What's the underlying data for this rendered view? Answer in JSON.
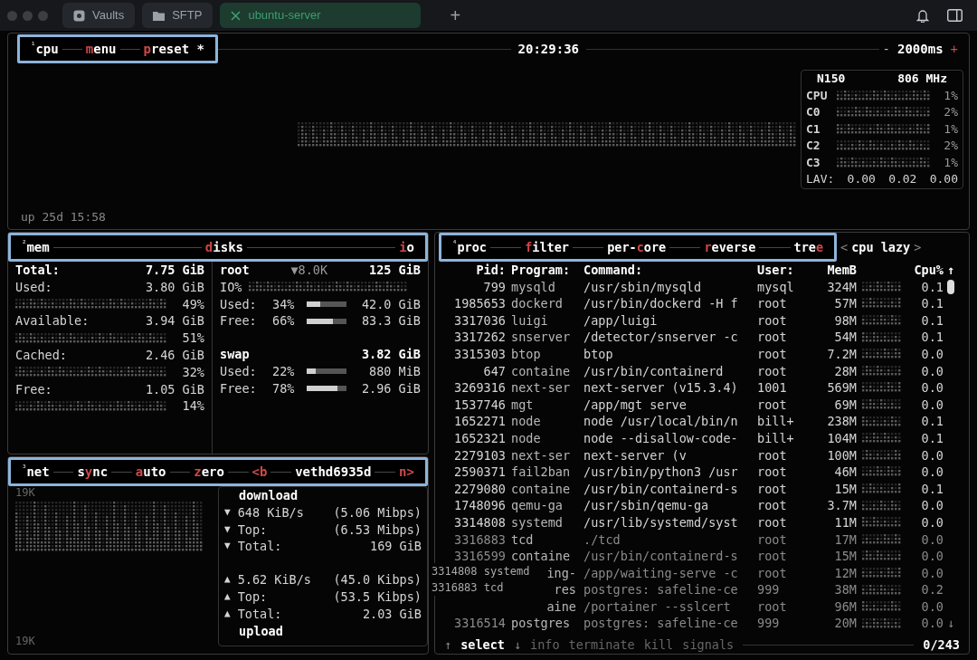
{
  "window": {
    "new_tab": "+"
  },
  "tabs": [
    {
      "label": "Vaults",
      "kind": "vault",
      "selected": false
    },
    {
      "label": "SFTP",
      "kind": "folder",
      "selected": false
    },
    {
      "label": "ubuntu-server",
      "kind": "close",
      "selected": true
    }
  ],
  "cpu": {
    "header": [
      {
        "kind": "title",
        "number": "¹",
        "text": "cpu"
      },
      {
        "kind": "button",
        "hot": "m",
        "post": "enu"
      },
      {
        "kind": "button",
        "hot": "p",
        "post": "reset *"
      }
    ],
    "clock": "20:29:36",
    "interval_minus": "-",
    "interval": "2000ms",
    "interval_plus": "+",
    "model": "N150",
    "frequency": "806 MHz",
    "cores": [
      {
        "name": "CPU",
        "percent": "1%"
      },
      {
        "name": "C0",
        "percent": "2%"
      },
      {
        "name": "C1",
        "percent": "1%"
      },
      {
        "name": "C2",
        "percent": "2%"
      },
      {
        "name": "C3",
        "percent": "1%"
      }
    ],
    "load_label": "LAV:",
    "load": [
      "0.00",
      "0.02",
      "0.00"
    ],
    "uptime": "up 25d 15:58"
  },
  "mem": {
    "header": [
      {
        "kind": "title",
        "number": "²",
        "text": "mem"
      },
      {
        "kind": "button",
        "hot": "d",
        "post": "isks"
      },
      {
        "kind": "button",
        "hot": "i",
        "post": "o"
      }
    ],
    "total_label": "Total:",
    "total": "7.75 GiB",
    "items": [
      {
        "label": "Used:",
        "value": "3.80 GiB",
        "percent": "49%"
      },
      {
        "label": "Available:",
        "value": "3.94 GiB",
        "percent": "51%"
      },
      {
        "label": "Cached:",
        "value": "2.46 GiB",
        "percent": "32%"
      },
      {
        "label": "Free:",
        "value": "1.05 GiB",
        "percent": "14%"
      }
    ]
  },
  "disks": [
    {
      "name": "root",
      "io": "▼8.0K",
      "size": "125 GiB",
      "io_label": "IO%",
      "rows": [
        {
          "label": "Used:",
          "percent": "34%",
          "level": 0.34,
          "value": "42.0 GiB"
        },
        {
          "label": "Free:",
          "percent": "66%",
          "level": 0.66,
          "value": "83.3 GiB"
        }
      ]
    },
    {
      "name": "swap",
      "size": "3.82 GiB",
      "rows": [
        {
          "label": "Used:",
          "percent": "22%",
          "level": 0.22,
          "value": "880 MiB"
        },
        {
          "label": "Free:",
          "percent": "78%",
          "level": 0.78,
          "value": "2.96 GiB"
        }
      ]
    }
  ],
  "net": {
    "header": [
      {
        "kind": "title",
        "number": "³",
        "text": "net"
      },
      {
        "kind": "button",
        "pre": "s",
        "hot": "y",
        "post": "nc"
      },
      {
        "kind": "button",
        "hot": "a",
        "post": "uto"
      },
      {
        "kind": "button",
        "hot": "z",
        "post": "ero"
      },
      {
        "kind": "button",
        "hot": "<b"
      },
      {
        "kind": "plain",
        "pre": "vethd6935d"
      },
      {
        "kind": "button",
        "hot": "n>"
      }
    ],
    "scale_top": "19K",
    "scale_bottom": "19K",
    "download_label": "download",
    "upload_label": "upload",
    "download": [
      {
        "arrow": "▼",
        "label": "648 KiB/s",
        "value": "(5.06 Mibps)"
      },
      {
        "arrow": "▼",
        "label": "Top:",
        "value": "(6.53 Mibps)"
      },
      {
        "arrow": "▼",
        "label": "Total:",
        "value": "169 GiB"
      }
    ],
    "upload": [
      {
        "arrow": "▲",
        "label": "5.62 KiB/s",
        "value": "(45.0 Kibps)"
      },
      {
        "arrow": "▲",
        "label": "Top:",
        "value": "(53.5 Kibps)"
      },
      {
        "arrow": "▲",
        "label": "Total:",
        "value": "2.03 GiB"
      }
    ]
  },
  "proc": {
    "header": [
      {
        "kind": "title",
        "number": "⁴",
        "text": "proc"
      },
      {
        "kind": "button",
        "hot": "f",
        "post": "ilter"
      },
      {
        "kind": "button",
        "pre": "per-",
        "hot": "c",
        "post": "ore"
      },
      {
        "kind": "button",
        "hot": "r",
        "post": "everse"
      },
      {
        "kind": "button",
        "pre": "tre",
        "hot": "e"
      }
    ],
    "sort_prev": "<",
    "sort": "cpu lazy",
    "sort_next": ">",
    "columns": [
      "Pid:",
      "Program:",
      "Command:",
      "User:",
      "MemB",
      "Cpu%"
    ],
    "scroll_up": "↑",
    "scroll_down": "↓",
    "rows": [
      {
        "pid": "799",
        "program": "mysqld",
        "command": "/usr/sbin/mysqld",
        "user": "mysql",
        "mem": "324M",
        "cpu": "0.1"
      },
      {
        "pid": "1985653",
        "program": "dockerd",
        "command": "/usr/bin/dockerd -H f",
        "user": "root",
        "mem": "57M",
        "cpu": "0.1"
      },
      {
        "pid": "3317036",
        "program": "luigi",
        "command": "/app/luigi",
        "user": "root",
        "mem": "98M",
        "cpu": "0.1"
      },
      {
        "pid": "3317262",
        "program": "snserver",
        "command": "/detector/snserver -c",
        "user": "root",
        "mem": "54M",
        "cpu": "0.1"
      },
      {
        "pid": "3315303",
        "program": "btop",
        "command": "btop",
        "user": "root",
        "mem": "7.2M",
        "cpu": "0.0"
      },
      {
        "pid": "647",
        "program": "containe",
        "command": "/usr/bin/containerd",
        "user": "root",
        "mem": "28M",
        "cpu": "0.0"
      },
      {
        "pid": "3269316",
        "program": "next-ser",
        "command": "next-server (v15.3.4)",
        "user": "1001",
        "mem": "569M",
        "cpu": "0.0"
      },
      {
        "pid": "1537746",
        "program": "mgt",
        "command": "/app/mgt serve",
        "user": "root",
        "mem": "69M",
        "cpu": "0.0"
      },
      {
        "pid": "1652271",
        "program": "node",
        "command": "node /usr/local/bin/n",
        "user": "bill+",
        "mem": "238M",
        "cpu": "0.1"
      },
      {
        "pid": "1652321",
        "program": "node",
        "command": "node --disallow-code-",
        "user": "bill+",
        "mem": "104M",
        "cpu": "0.1"
      },
      {
        "pid": "2279103",
        "program": "next-ser",
        "command": "next-server (v",
        "user": "root",
        "mem": "100M",
        "cpu": "0.0"
      },
      {
        "pid": "2590371",
        "program": "fail2ban",
        "command": "/usr/bin/python3 /usr",
        "user": "root",
        "mem": "46M",
        "cpu": "0.0"
      },
      {
        "pid": "2279080",
        "program": "containe",
        "command": "/usr/bin/containerd-s",
        "user": "root",
        "mem": "15M",
        "cpu": "0.1"
      },
      {
        "pid": "1748096",
        "program": "qemu-ga",
        "command": "/usr/sbin/qemu-ga",
        "user": "root",
        "mem": "3.7M",
        "cpu": "0.0"
      },
      {
        "pid": "3314808",
        "program": "systemd",
        "command": "/usr/lib/systemd/syst",
        "user": "root",
        "mem": "11M",
        "cpu": "0.0"
      },
      {
        "pid": "3316883",
        "program": "tcd",
        "command": "./tcd",
        "user": "root",
        "mem": "17M",
        "cpu": "0.0"
      },
      {
        "pid": "3316599",
        "program": "containe",
        "command": "/usr/bin/containerd-s",
        "user": "root",
        "mem": "15M",
        "cpu": "0.0"
      },
      {
        "program": "ing-",
        "command": "/app/waiting-serve -c",
        "user": "root",
        "mem": "12M",
        "cpu": "0.0"
      },
      {
        "program": "res",
        "command": "postgres: safeline-ce",
        "user": "999",
        "mem": "38M",
        "cpu": "0.2"
      },
      {
        "program": "aine",
        "command": "/portainer --sslcert",
        "user": "root",
        "mem": "96M",
        "cpu": "0.0"
      },
      {
        "pid": "3316514",
        "program": "postgres",
        "command": "postgres: safeline-ce",
        "user": "999",
        "mem": "20M",
        "cpu": "0.0"
      }
    ],
    "ghost_lines": [
      {
        "pid": "3314808",
        "program": "systemd"
      },
      {
        "pid": "3316883",
        "program": "tcd"
      }
    ],
    "footer": {
      "up": "↑",
      "select": "select",
      "down": "↓",
      "actions": [
        "info",
        "terminate",
        "kill",
        "signals"
      ],
      "count": "0/243"
    }
  }
}
